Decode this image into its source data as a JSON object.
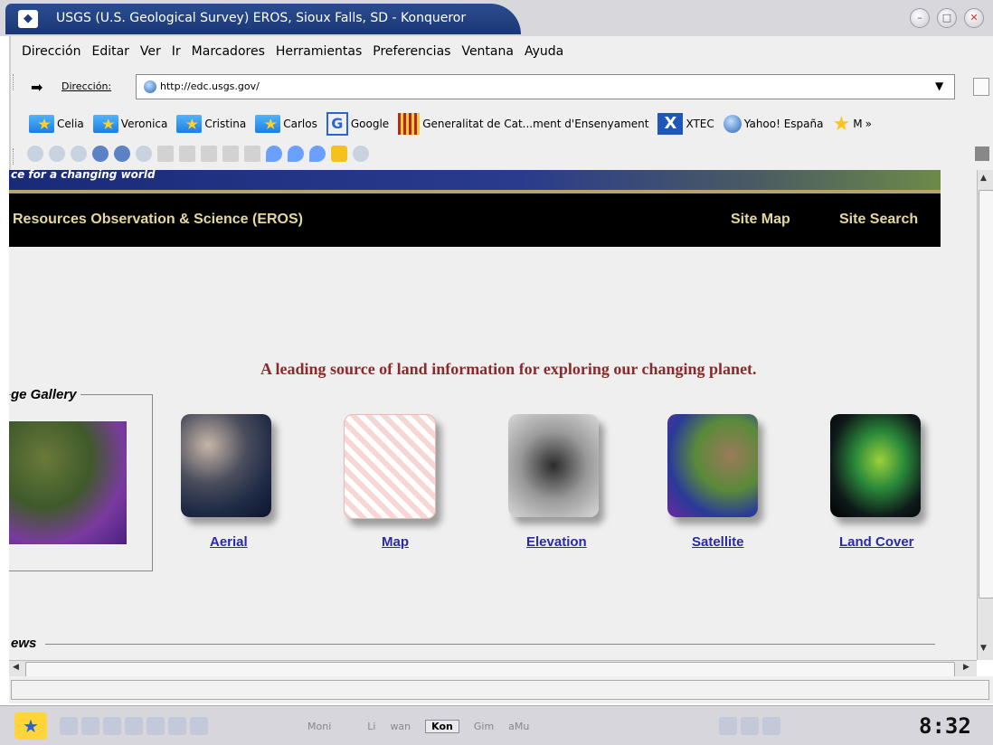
{
  "window": {
    "title": "USGS (U.S. Geological Survey) EROS, Sioux Falls, SD - Konqueror"
  },
  "menubar": [
    "Dirección",
    "Editar",
    "Ver",
    "Ir",
    "Marcadores",
    "Herramientas",
    "Preferencias",
    "Ventana",
    "Ayuda"
  ],
  "address": {
    "label": "Dirección:",
    "url": "http://edc.usgs.gov/"
  },
  "bookmarks": [
    "Celia",
    "Veronica",
    "Cristina",
    "Carlos",
    "Google",
    "Generalitat de Cat...ment d'Ensenyament",
    "XTEC",
    "Yahoo! España",
    "M"
  ],
  "page": {
    "tagline_strip": "ce for a changing world",
    "header_title": "Resources Observation & Science (EROS)",
    "site_map": "Site Map",
    "site_search": "Site Search",
    "tagline": "A leading source of land information for exploring our changing planet.",
    "gallery_title": "ge Gallery",
    "thumbs": [
      "Aerial",
      "Map",
      "Elevation",
      "Satellite",
      "Land Cover"
    ],
    "news_title": "ews"
  },
  "taskbar": {
    "items": [
      "Moni",
      "Li",
      "wan",
      "Kon",
      "Gim",
      "aMu"
    ],
    "clock": "8:32"
  }
}
